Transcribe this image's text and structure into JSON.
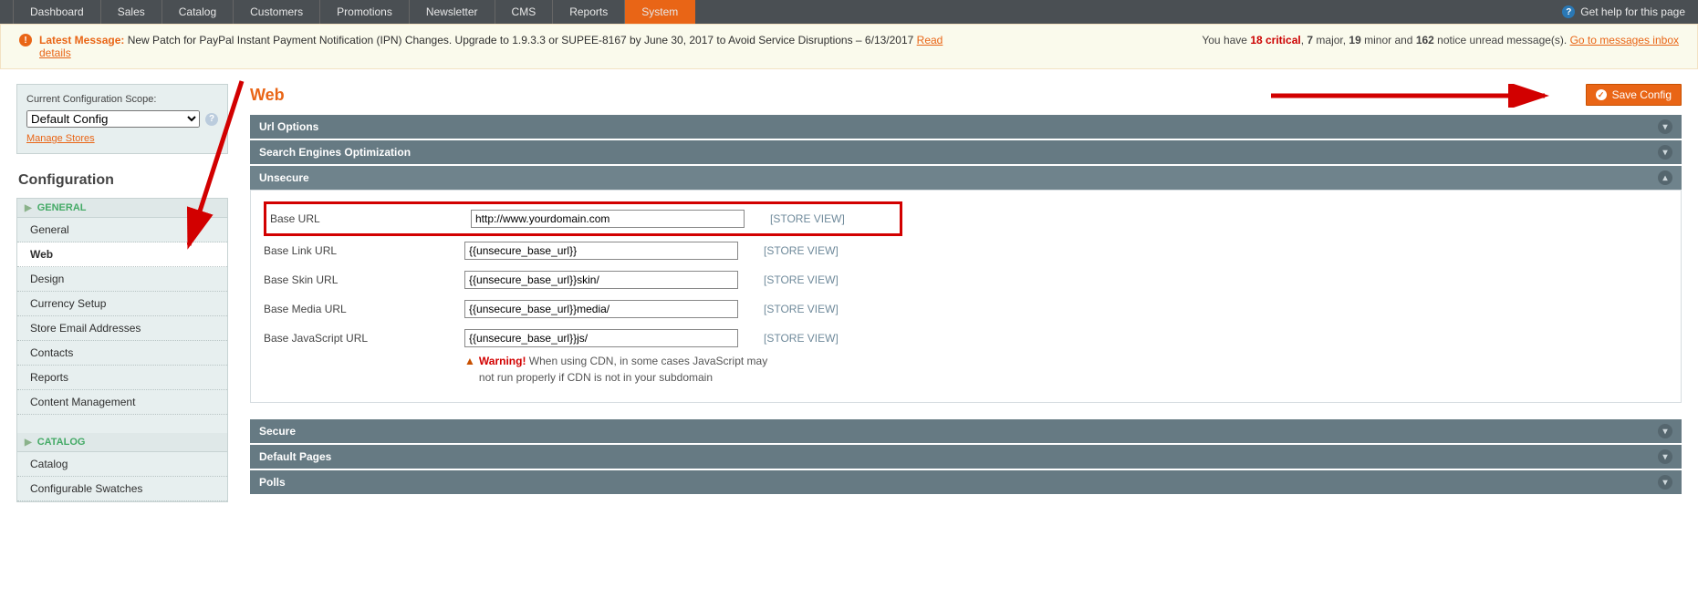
{
  "topnav": {
    "items": [
      "Dashboard",
      "Sales",
      "Catalog",
      "Customers",
      "Promotions",
      "Newsletter",
      "CMS",
      "Reports",
      "System"
    ],
    "active_index": 8,
    "help_text": "Get help for this page"
  },
  "msgbar": {
    "latest_label": "Latest Message:",
    "latest_text": " New Patch for PayPal Instant Payment Notification (IPN) Changes. Upgrade to 1.9.3.3 or SUPEE-8167 by June 30, 2017 to Avoid Service Disruptions – 6/13/2017 ",
    "read_details": "Read details",
    "right_pre": "You have ",
    "critical_n": "18",
    "critical_t": " critical",
    "comma": ", ",
    "major_n": "7",
    "major_t": " major",
    "minor_n": "19",
    "minor_t": " minor and ",
    "notice_n": "162",
    "notice_t": " notice unread message(s). ",
    "inbox_link": "Go to messages inbox"
  },
  "sidebar": {
    "scope_label": "Current Configuration Scope:",
    "scope_value": "Default Config",
    "manage_stores": "Manage Stores",
    "conf_heading": "Configuration",
    "sections": [
      {
        "title": "GENERAL",
        "items": [
          "General",
          "Web",
          "Design",
          "Currency Setup",
          "Store Email Addresses",
          "Contacts",
          "Reports",
          "Content Management"
        ],
        "active_index": 1
      },
      {
        "title": "CATALOG",
        "items": [
          "Catalog",
          "Configurable Swatches"
        ],
        "active_index": -1
      }
    ]
  },
  "page": {
    "title": "Web",
    "save_label": "Save Config"
  },
  "panels": {
    "url_options": "Url Options",
    "seo": "Search Engines Optimization",
    "unsecure": "Unsecure",
    "secure": "Secure",
    "default_pages": "Default Pages",
    "polls": "Polls"
  },
  "unsecure": {
    "rows": [
      {
        "label": "Base URL",
        "value": "http://www.yourdomain.com",
        "scope": "[STORE VIEW]",
        "highlight": true
      },
      {
        "label": "Base Link URL",
        "value": "{{unsecure_base_url}}",
        "scope": "[STORE VIEW]"
      },
      {
        "label": "Base Skin URL",
        "value": "{{unsecure_base_url}}skin/",
        "scope": "[STORE VIEW]"
      },
      {
        "label": "Base Media URL",
        "value": "{{unsecure_base_url}}media/",
        "scope": "[STORE VIEW]"
      },
      {
        "label": "Base JavaScript URL",
        "value": "{{unsecure_base_url}}js/",
        "scope": "[STORE VIEW]"
      }
    ],
    "warning_label": "Warning!",
    "warning_text": " When using CDN, in some cases JavaScript may not run properly if CDN is not in your subdomain"
  }
}
